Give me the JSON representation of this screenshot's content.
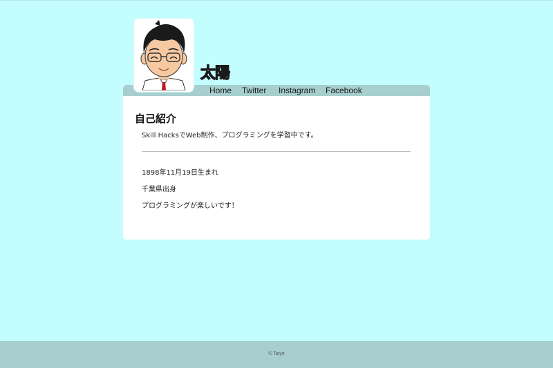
{
  "header": {
    "site_title": "太陽",
    "avatar_label": "avatar"
  },
  "nav": {
    "items": [
      {
        "label": "Home"
      },
      {
        "label": "Twitter"
      },
      {
        "label": "Instagram"
      },
      {
        "label": "Facebook"
      }
    ]
  },
  "main": {
    "section_title": "自己紹介",
    "intro": "Skill HacksでWeb制作、プログラミングを学習中です。",
    "facts": [
      "1898年11月19日生まれ",
      "千葉県出身",
      "プログラミングが楽しいです！"
    ]
  },
  "footer": {
    "copyright": "© Taiyo"
  },
  "colors": {
    "background": "#c4fdfe",
    "accent_bar": "#a7cfcf",
    "card": "#ffffff"
  }
}
